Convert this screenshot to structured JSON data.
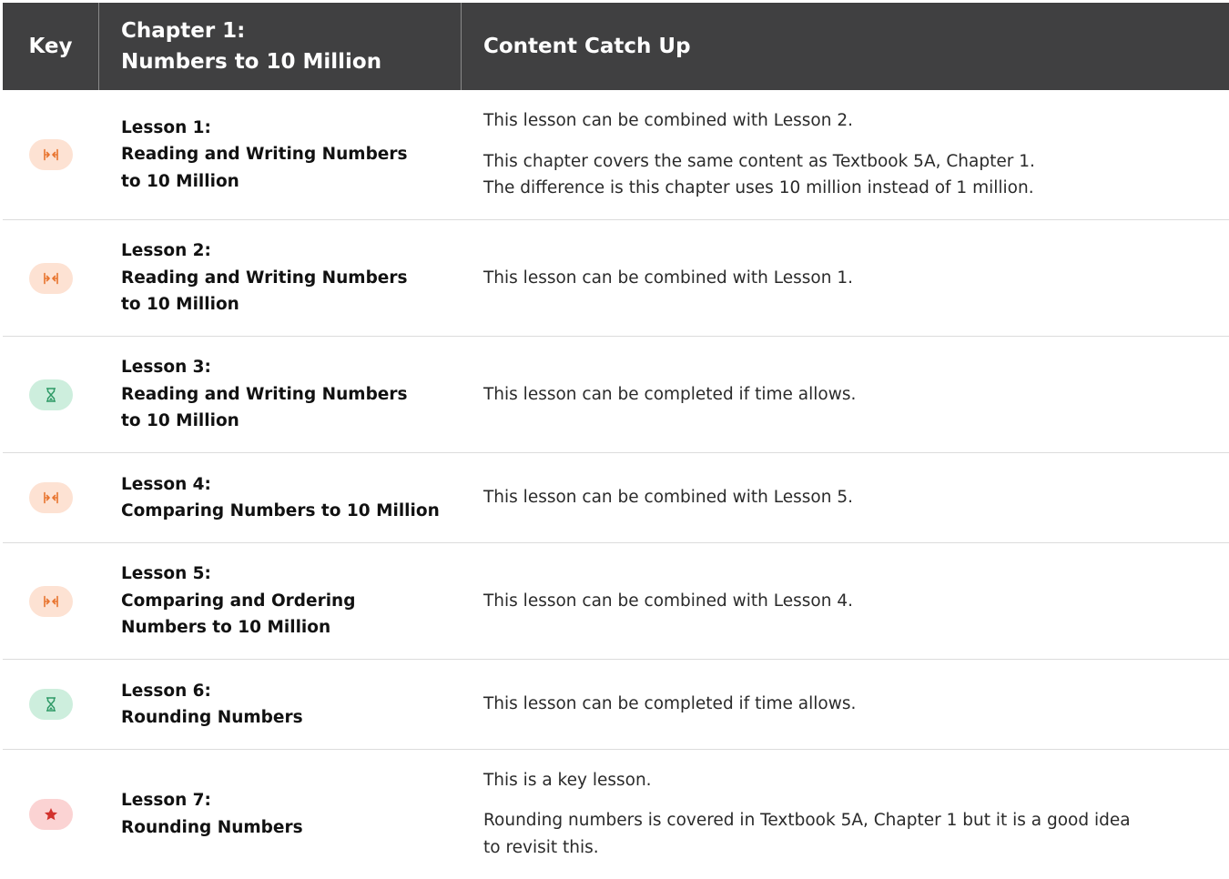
{
  "header": {
    "key": "Key",
    "chapter_line1": "Chapter 1:",
    "chapter_line2": "Numbers to 10 Million",
    "catch_up": "Content Catch Up"
  },
  "colors": {
    "header_bg": "#404041",
    "combine_pill": "#fde2d3",
    "combine_icon": "#e8742e",
    "time_pill": "#cdeedd",
    "time_icon": "#2f9a67",
    "key_pill": "#fbd3d3",
    "key_icon": "#d2322d"
  },
  "rows": [
    {
      "icon": "combine-arrows-icon",
      "lesson": "Lesson 1:",
      "title1": "Reading and Writing Numbers",
      "title2": "to 10 Million",
      "notes": [
        "This lesson can be combined with Lesson 2.",
        "This chapter covers the same content as Textbook 5A, Chapter 1.",
        "The difference is this chapter uses 10 million instead of 1 million."
      ]
    },
    {
      "icon": "combine-arrows-icon",
      "lesson": "Lesson 2:",
      "title1": "Reading and Writing Numbers",
      "title2": "to 10 Million",
      "notes": [
        "This lesson can be combined with Lesson 1."
      ]
    },
    {
      "icon": "hourglass-icon",
      "lesson": "Lesson 3:",
      "title1": "Reading and Writing Numbers",
      "title2": "to 10 Million",
      "notes": [
        "This lesson can be completed if time allows."
      ]
    },
    {
      "icon": "combine-arrows-icon",
      "lesson": "Lesson 4:",
      "title1": "Comparing Numbers to 10 Million",
      "notes": [
        "This lesson can be combined with Lesson 5."
      ]
    },
    {
      "icon": "combine-arrows-icon",
      "lesson": "Lesson 5:",
      "title1": "Comparing and Ordering",
      "title2": "Numbers to 10 Million",
      "notes": [
        "This lesson can be combined with Lesson 4."
      ]
    },
    {
      "icon": "hourglass-icon",
      "lesson": "Lesson 6:",
      "title1": "Rounding Numbers",
      "notes": [
        "This lesson can be completed if time allows."
      ]
    },
    {
      "icon": "star-icon",
      "lesson": "Lesson 7:",
      "title1": "Rounding Numbers",
      "notes": [
        "This is a key lesson.",
        "Rounding numbers is covered in Textbook 5A, Chapter 1 but it is a good idea",
        "to revisit this."
      ]
    }
  ]
}
